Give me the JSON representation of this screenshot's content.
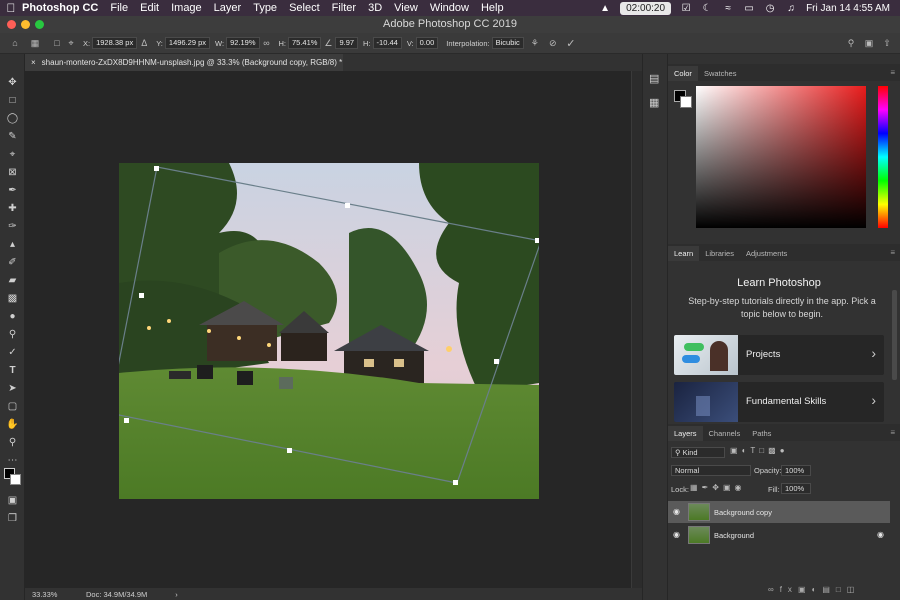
{
  "menubar": {
    "app": "Photoshop CC",
    "items": [
      "File",
      "Edit",
      "Image",
      "Layer",
      "Type",
      "Select",
      "Filter",
      "3D",
      "View",
      "Window",
      "Help"
    ],
    "timer": "02:00:20",
    "clock": "Fri Jan 14  4:55 AM"
  },
  "window": {
    "title": "Adobe Photoshop CC 2019"
  },
  "options": {
    "x_label": "X:",
    "x": "1928.38 px",
    "y_label": "Y:",
    "y": "1496.29 px",
    "w_label": "W:",
    "w": "92.19%",
    "h_label": "H:",
    "h": "75.41%",
    "angle": "9.97",
    "hskew_label": "H:",
    "hskew": "-10.44",
    "vskew_label": "V:",
    "vskew": "0.00",
    "interp_label": "Interpolation:",
    "interp": "Bicubic"
  },
  "document": {
    "tab": "shaun-montero-ZxDX8D9HHNM-unsplash.jpg @ 33.3% (Background copy, RGB/8) *",
    "zoom": "33.33%",
    "doc_size": "Doc: 34.9M/34.9M"
  },
  "color_panel": {
    "tabs": [
      "Color",
      "Swatches"
    ]
  },
  "learn_panel": {
    "tabs": [
      "Learn",
      "Libraries",
      "Adjustments"
    ],
    "title": "Learn Photoshop",
    "description": "Step-by-step tutorials directly in the app. Pick a topic below to begin.",
    "cards": [
      "Projects",
      "Fundamental Skills"
    ]
  },
  "layers_panel": {
    "tabs": [
      "Layers",
      "Channels",
      "Paths"
    ],
    "filter": "Kind",
    "blend_mode": "Normal",
    "opacity_label": "Opacity:",
    "opacity": "100%",
    "lock_label": "Lock:",
    "fill_label": "Fill:",
    "fill": "100%",
    "layers": [
      "Background copy",
      "Background"
    ]
  },
  "colors": {
    "accent": "#3a2d3e",
    "panel": "#323232",
    "canvas": "#262626"
  }
}
